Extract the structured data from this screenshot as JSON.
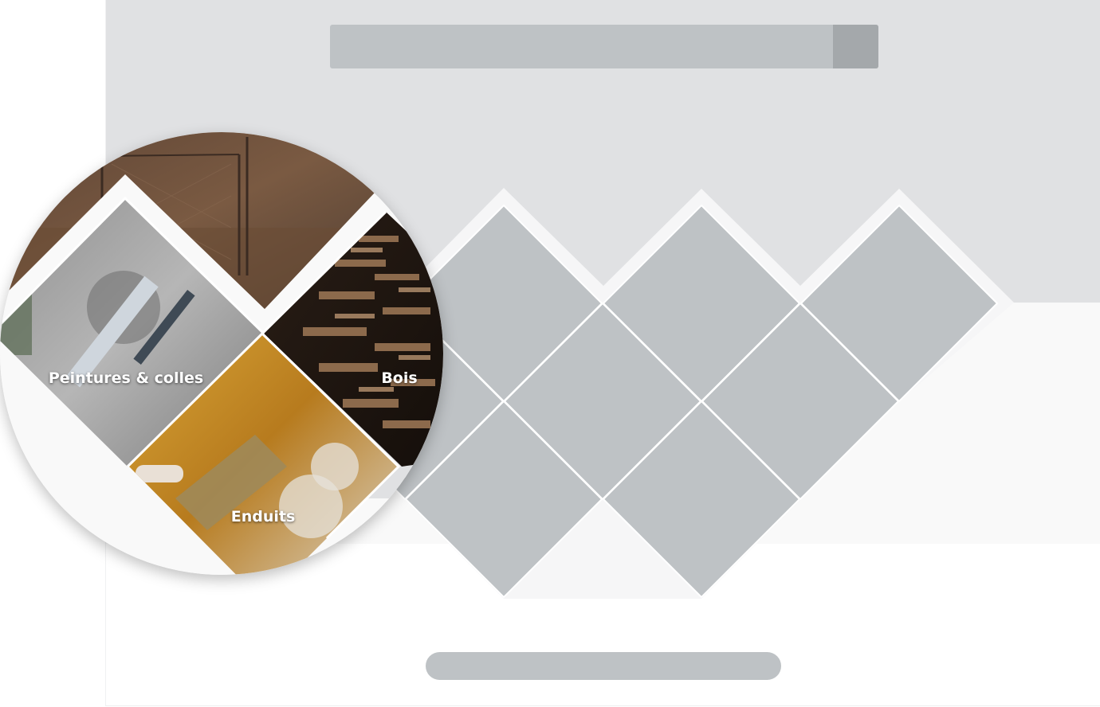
{
  "categories": [
    {
      "label": "Peintures & colles",
      "image": "paint-brush-photo"
    },
    {
      "label": "Bois",
      "image": "stacked-wood-photo"
    },
    {
      "label": "Enduits",
      "image": "plaster-trowel-photo"
    }
  ],
  "colors": {
    "hero_background": "#e0e1e3",
    "band_background": "#f9f9f9",
    "placeholder": "#bec2c5",
    "placeholder_dark": "#a4a8ab"
  }
}
